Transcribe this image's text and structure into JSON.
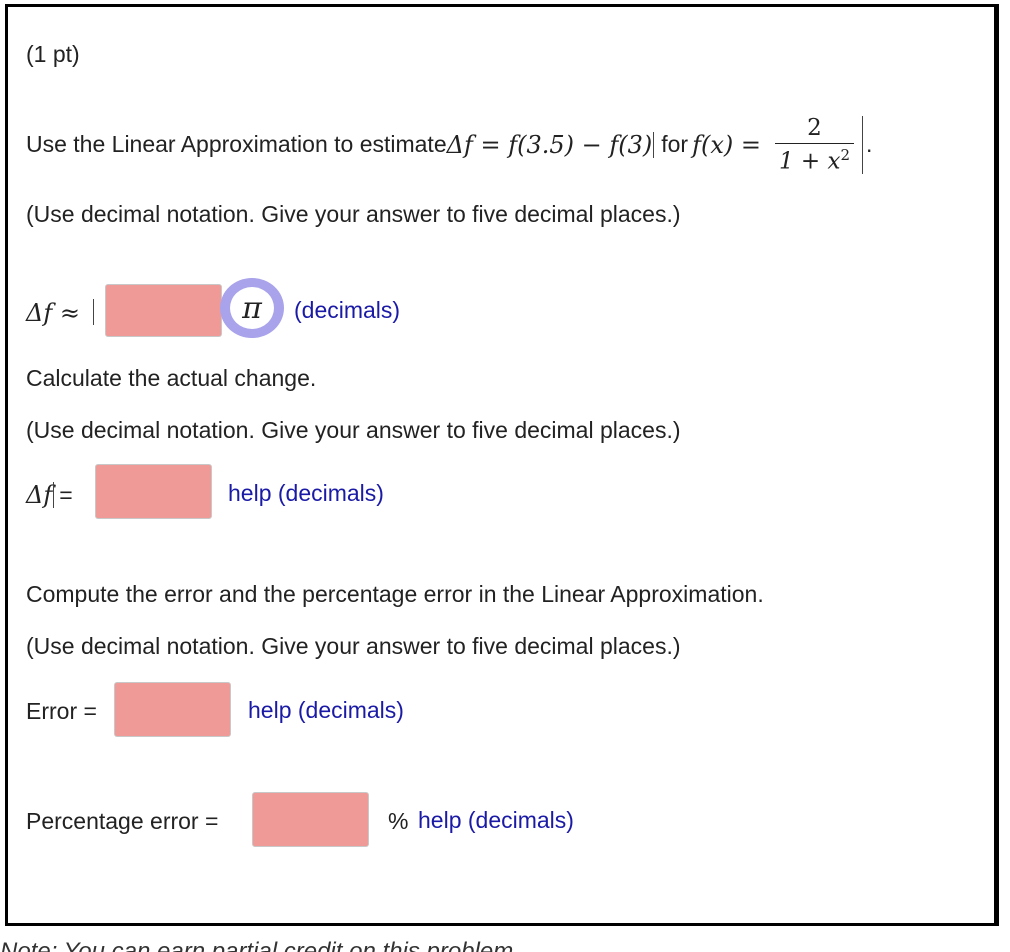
{
  "problem": {
    "points": "(1 pt)",
    "intro": "Use the Linear Approximation to estimate ",
    "delta_expr": "Δf = f(3.5) − f(3)",
    "for_text": "for",
    "func_lhs": "f(x) =",
    "frac_num": "2",
    "frac_den": "1 + x",
    "frac_den_exp": "2",
    "instruction": "(Use decimal notation. Give your answer to five decimal places.)"
  },
  "part1": {
    "label": "Δf ≈",
    "pi_symbol": "π",
    "help": "(decimals)",
    "value": ""
  },
  "part2": {
    "heading": "Calculate the actual change.",
    "instruction": "(Use decimal notation. Give your answer to five decimal places.)",
    "label": "Δf",
    "equals": "=",
    "help": "help (decimals)",
    "value": ""
  },
  "part3": {
    "heading": "Compute the error and the percentage error in the Linear Approximation.",
    "instruction": "(Use decimal notation. Give your answer to five decimal places.)",
    "error_label": "Error =",
    "error_help": "help (decimals)",
    "error_value": "",
    "pct_label": "Percentage error =",
    "pct_unit": "%",
    "pct_help": "help (decimals)",
    "pct_value": ""
  },
  "footer": {
    "note": "Note: You can earn partial credit on this problem."
  },
  "colors": {
    "answer_bg": "#f09a97",
    "link": "#1a1aa6",
    "pi_ring": "#a8a3ea"
  }
}
